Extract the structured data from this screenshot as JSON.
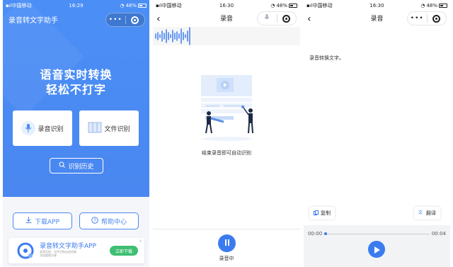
{
  "phones": [
    {
      "status": {
        "carrier": "中国移动",
        "time": "16:29",
        "battery": "48%"
      },
      "title": "录音转文字助手",
      "capsule_dots": "•••",
      "hero": {
        "line1": "语音实时转换",
        "line2": "轻松不打字"
      },
      "cards": [
        {
          "label": "录音识别"
        },
        {
          "label": "文件识别"
        }
      ],
      "history_button": "识别历史",
      "download_button": "下载APP",
      "help_button": "帮助中心",
      "banner": {
        "title": "录音转文字助手APP",
        "subtitle": "录音识别、文件识别自由切换 文档管理方便",
        "button": "立即下载",
        "close": "×"
      }
    },
    {
      "status": {
        "carrier": "中国移动",
        "time": "16:30",
        "battery": "48%"
      },
      "title": "录音",
      "back": "‹",
      "empty_text": "结束录音即可自动识别",
      "record_label": "录音中"
    },
    {
      "status": {
        "carrier": "中国移动",
        "time": "16:30",
        "battery": "48%"
      },
      "title": "录音",
      "back": "‹",
      "capsule_dots": "•••",
      "result_text": "录音转换文字。",
      "copy_button": "复制",
      "translate_button": "翻译",
      "time_start": "00:00",
      "time_end": "00:04"
    }
  ],
  "colors": {
    "primary": "#4a87f0",
    "green": "#3fbf74",
    "panel": "#f2f3f5"
  },
  "icons": [
    "signal-icon",
    "wifi-icon",
    "battery-icon",
    "more-icon",
    "target-icon",
    "microphone-icon",
    "file-icon",
    "search-icon",
    "download-icon",
    "help-icon",
    "pause-icon",
    "play-icon",
    "copy-icon",
    "translate-icon",
    "back-icon"
  ]
}
